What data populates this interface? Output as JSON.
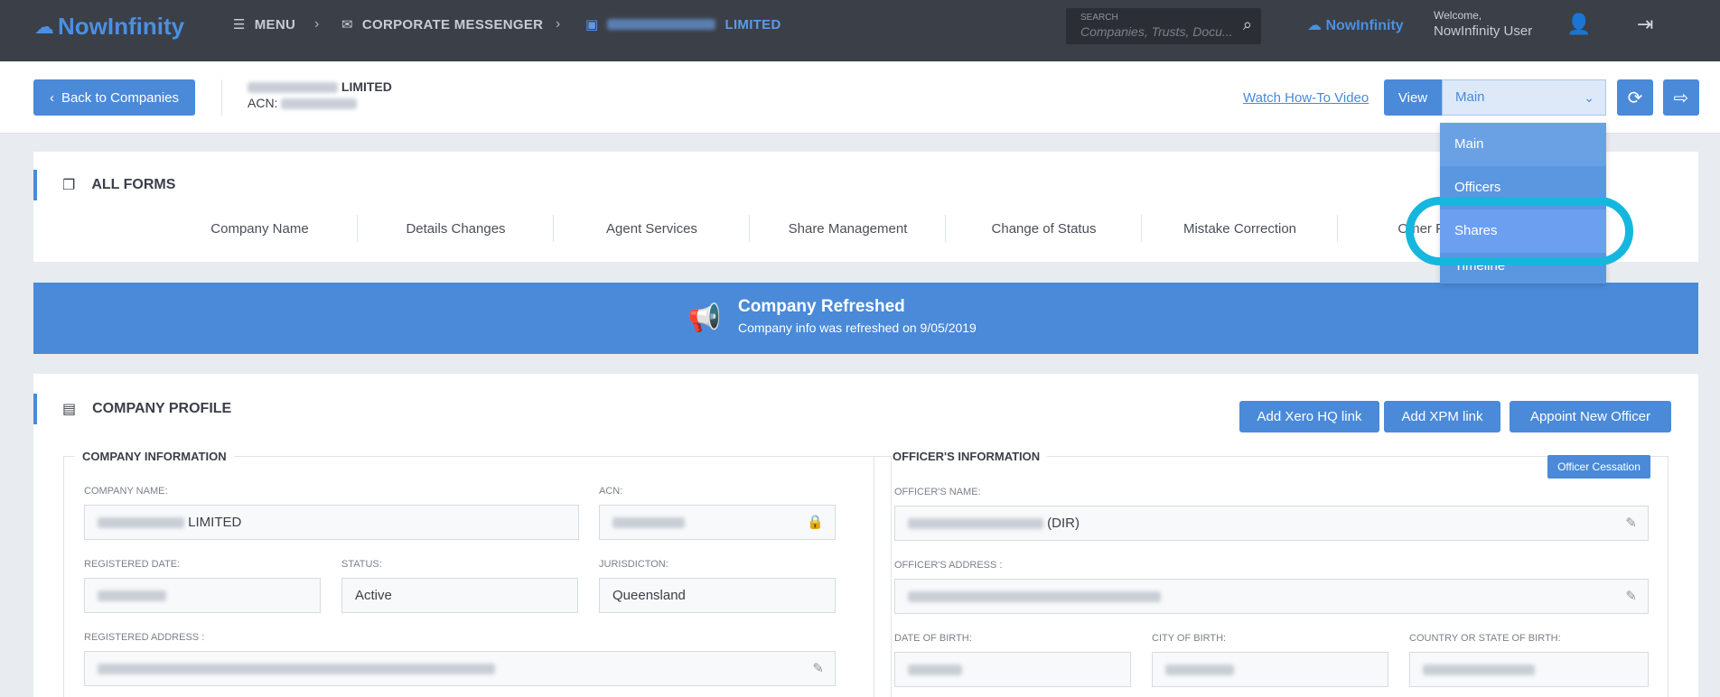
{
  "topnav": {
    "logo": "NowInfinity",
    "menu": "MENU",
    "corporate": "CORPORATE MESSENGER",
    "company_suffix": "LIMITED",
    "search_label": "SEARCH",
    "search_placeholder": "Companies, Trusts, Docu...",
    "logo_small": "NowInfinity",
    "welcome": "Welcome,",
    "user": "NowInfinity User"
  },
  "header": {
    "back": "Back to Companies",
    "company_suffix": "LIMITED",
    "acn_label": "ACN:",
    "howto": "Watch How-To Video",
    "view_label": "View",
    "view_selected": "Main"
  },
  "view_options": [
    "Main",
    "Officers",
    "Shares",
    "Timeline"
  ],
  "forms": {
    "title": "ALL FORMS",
    "links": [
      "Company Name",
      "Details Changes",
      "Agent Services",
      "Share Management",
      "Change of Status",
      "Mistake Correction",
      "Other Forms"
    ]
  },
  "banner": {
    "title": "Company Refreshed",
    "message": "Company info was refreshed on 9/05/2019"
  },
  "profile": {
    "title": "COMPANY PROFILE",
    "actions": [
      "Add Xero HQ link",
      "Add XPM link",
      "Appoint New Officer"
    ],
    "company_info": {
      "legend": "COMPANY INFORMATION",
      "company_name_label": "COMPANY NAME:",
      "company_name_suffix": "LIMITED",
      "acn_label": "ACN:",
      "registered_date_label": "REGISTERED DATE:",
      "status_label": "STATUS:",
      "status_value": "Active",
      "jurisdiction_label": "JURISDICTON:",
      "jurisdiction_value": "Queensland",
      "registered_address_label": "REGISTERED ADDRESS :"
    },
    "officer_info": {
      "legend": "OFFICER'S INFORMATION",
      "cessation": "Officer Cessation",
      "name_label": "OFFICER'S NAME:",
      "name_suffix": "(DIR)",
      "address_label": "OFFICER'S ADDRESS :",
      "dob_label": "DATE OF BIRTH:",
      "city_label": "CITY OF BIRTH:",
      "country_label": "COUNTRY OR STATE OF BIRTH:"
    }
  },
  "colors": {
    "accent": "#4a8ad8",
    "nav_bg": "#3b3f48",
    "highlight": "#16b7de"
  }
}
